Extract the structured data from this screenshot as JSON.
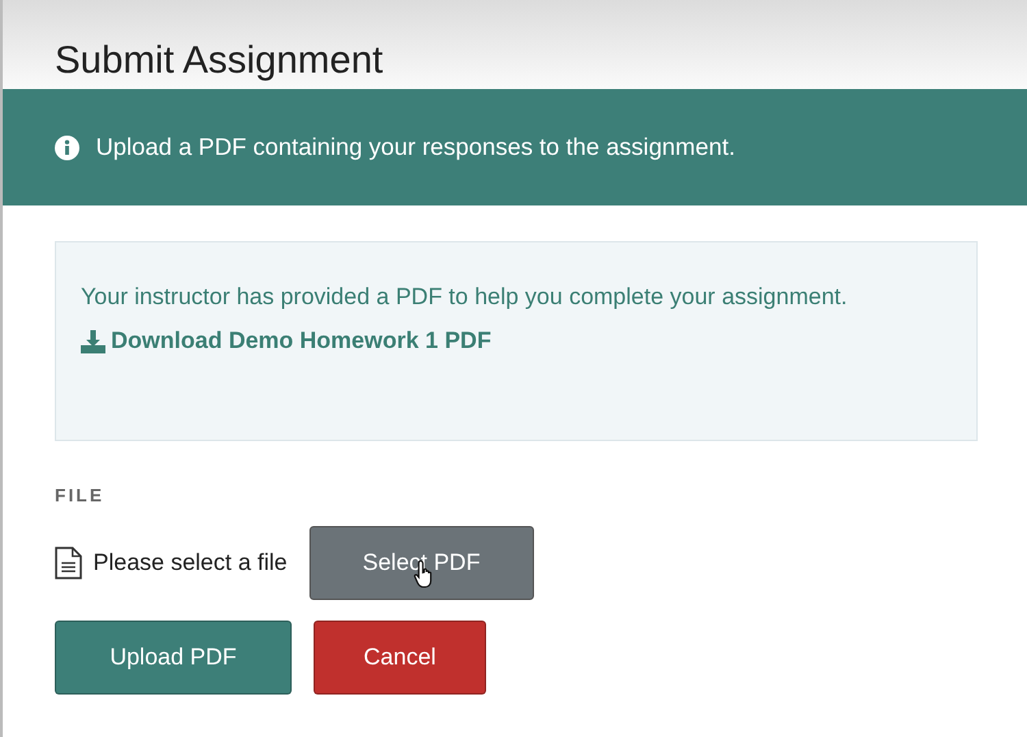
{
  "modal": {
    "title": "Submit Assignment"
  },
  "banner": {
    "text": "Upload a PDF containing your responses to the assignment."
  },
  "info_box": {
    "text": "Your instructor has provided a PDF to help you complete your assignment.",
    "link": "Download Demo Homework 1 PDF"
  },
  "file": {
    "label": "FILE",
    "status": "Please select a file",
    "button": "Select PDF"
  },
  "buttons": [
    {
      "label": "Upload PDF",
      "kind": "primary"
    },
    {
      "label": "Cancel",
      "kind": "danger"
    }
  ]
}
